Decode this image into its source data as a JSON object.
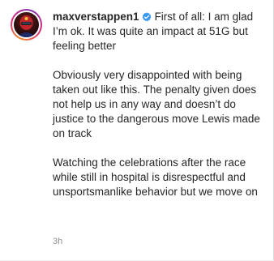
{
  "post": {
    "username": "maxverstappen1",
    "caption_intro": "First of all: I am glad I’m ok. It was quite an impact at 51G but feeling better",
    "caption_para2": "Obviously very disappointed with being taken out like this. The penalty given does not help us in any way and doesn’t do justice to the dangerous move Lewis made on track",
    "caption_para3": "Watching the celebrations after the race while still in hospital is disrespectful and unsportsmanlike behavior but we move on",
    "timestamp": "3h",
    "verified_icon": "verified-badge-icon",
    "colors": {
      "verified": "#3897f0",
      "text": "#262626",
      "muted": "#8e8e8e"
    }
  }
}
